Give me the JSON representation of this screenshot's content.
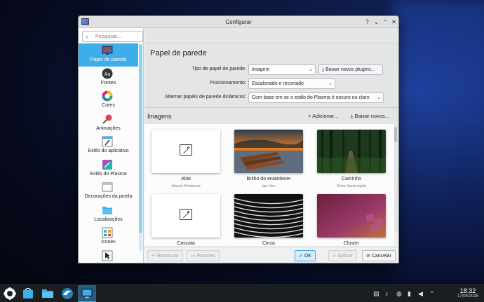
{
  "window": {
    "title": "Configurar",
    "controls": {
      "help": "?",
      "minimize": "⌄",
      "maximize": "⌃",
      "close": "✕"
    }
  },
  "sidebar": {
    "search_placeholder": "Pesquisar...",
    "items": [
      {
        "label": "Papel de parede",
        "icon": "wallpaper-icon",
        "selected": true
      },
      {
        "label": "Fontes",
        "icon": "fonts-icon",
        "selected": false
      },
      {
        "label": "Cores",
        "icon": "colors-icon",
        "selected": false
      },
      {
        "label": "Animações",
        "icon": "animations-icon",
        "selected": false
      },
      {
        "label": "Estilo do aplicativo",
        "icon": "application-style-icon",
        "selected": false
      },
      {
        "label": "Estilo do Plasma",
        "icon": "plasma-style-icon",
        "selected": false
      },
      {
        "label": "Decorações da janela",
        "icon": "window-decorations-icon",
        "selected": false
      },
      {
        "label": "Localizações",
        "icon": "locations-icon",
        "selected": false
      },
      {
        "label": "Ícones",
        "icon": "icons-icon",
        "selected": false
      }
    ]
  },
  "main": {
    "page_title": "Papel de parede",
    "form": {
      "type_label": "Tipo de papel de parede:",
      "type_value": "Imagem",
      "get_plugins": "Baixar novos plugins...",
      "position_label": "Posicionamento:",
      "position_value": "Escalonado e recortado",
      "dynamic_label": "Alternar papéis de parede dinâmicos:",
      "dynamic_value": "Com base em se o estilo do Plasma é escuro ou claro"
    },
    "images": {
      "heading": "Imagens",
      "add": "Adicionar...",
      "download": "Baixar novos...",
      "items": [
        {
          "name": "Altai",
          "author": "Alesya Khoteeva"
        },
        {
          "name": "Brilho do entardecer",
          "author": "Ian Hex"
        },
        {
          "name": "Caminho",
          "author": "Risto Saukonpää"
        },
        {
          "name": "Cascata",
          "author": ""
        },
        {
          "name": "Cinza",
          "author": ""
        },
        {
          "name": "Cluster",
          "author": ""
        }
      ]
    }
  },
  "buttons": {
    "reset": "Restaurar",
    "defaults": "Padrões",
    "ok": "OK",
    "apply": "Aplicar",
    "cancel": "Cancelar"
  },
  "taskbar": {
    "time": "18:32",
    "date": "17/04/2026"
  },
  "colors": {
    "accent": "#3daee9",
    "taskbar": "#1b1e20"
  }
}
